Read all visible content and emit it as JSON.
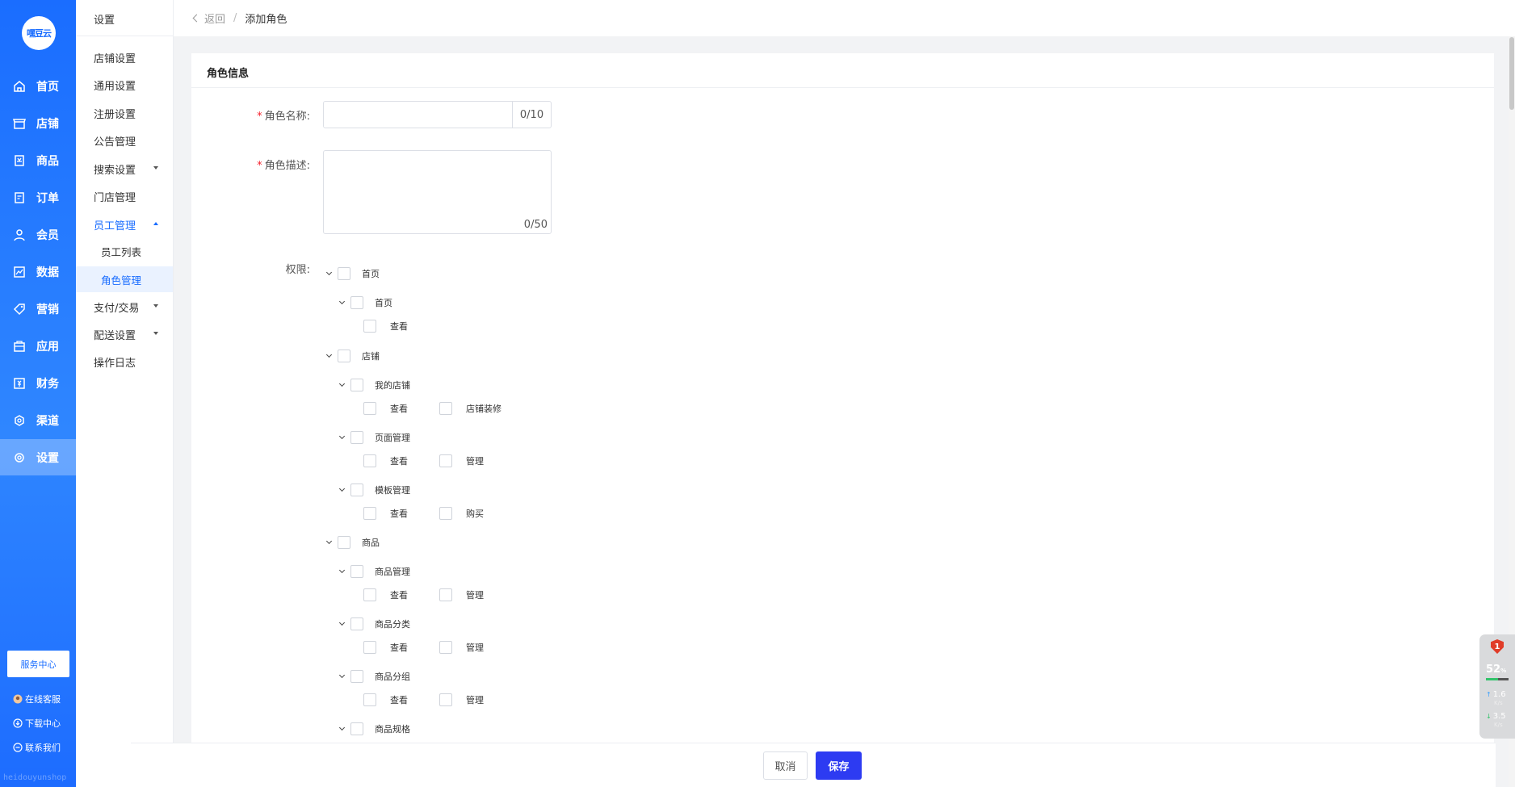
{
  "sidebar": {
    "logo": "嘿豆云",
    "items": [
      {
        "label": "首页",
        "icon": "home-icon"
      },
      {
        "label": "店铺",
        "icon": "store-icon"
      },
      {
        "label": "商品",
        "icon": "goods-icon"
      },
      {
        "label": "订单",
        "icon": "order-icon"
      },
      {
        "label": "会员",
        "icon": "user-icon"
      },
      {
        "label": "数据",
        "icon": "chart-icon"
      },
      {
        "label": "营销",
        "icon": "tag-icon"
      },
      {
        "label": "应用",
        "icon": "app-icon"
      },
      {
        "label": "财务",
        "icon": "finance-icon"
      },
      {
        "label": "渠道",
        "icon": "channel-icon"
      },
      {
        "label": "设置",
        "icon": "gear-icon",
        "active": true
      }
    ],
    "service_center": "服务中心",
    "online_service": "在线客服",
    "download_center": "下载中心",
    "contact_us": "联系我们",
    "watermark": "heidouyunshop"
  },
  "subnav": {
    "title": "设置",
    "items": [
      {
        "label": "店铺设置"
      },
      {
        "label": "通用设置"
      },
      {
        "label": "注册设置"
      },
      {
        "label": "公告管理"
      },
      {
        "label": "搜索设置",
        "caret": "down"
      },
      {
        "label": "门店管理"
      },
      {
        "label": "员工管理",
        "caret": "up",
        "expanded": true
      },
      {
        "label": "员工列表",
        "child": true
      },
      {
        "label": "角色管理",
        "child": true,
        "active": true
      },
      {
        "label": "支付/交易",
        "caret": "down"
      },
      {
        "label": "配送设置",
        "caret": "down"
      },
      {
        "label": "操作日志"
      }
    ]
  },
  "header": {
    "back": "返回",
    "separator": "/",
    "current": "添加角色"
  },
  "card": {
    "title": "角色信息",
    "name_label": "角色名称:",
    "name_value": "",
    "name_count": "0/10",
    "desc_label": "角色描述:",
    "desc_value": "",
    "desc_count": "0/50",
    "perm_label": "权限:"
  },
  "tree": [
    {
      "level": 0,
      "label": "首页",
      "toggle": true
    },
    {
      "level": 1,
      "label": "首页",
      "toggle": true
    },
    {
      "level": 2,
      "items": [
        "查看"
      ]
    },
    {
      "level": 0,
      "label": "店铺",
      "toggle": true
    },
    {
      "level": 1,
      "label": "我的店铺",
      "toggle": true
    },
    {
      "level": 2,
      "items": [
        "查看",
        "店铺装修"
      ]
    },
    {
      "level": 1,
      "label": "页面管理",
      "toggle": true
    },
    {
      "level": 2,
      "items": [
        "查看",
        "管理"
      ]
    },
    {
      "level": 1,
      "label": "模板管理",
      "toggle": true
    },
    {
      "level": 2,
      "items": [
        "查看",
        "购买"
      ]
    },
    {
      "level": 0,
      "label": "商品",
      "toggle": true
    },
    {
      "level": 1,
      "label": "商品管理",
      "toggle": true
    },
    {
      "level": 2,
      "items": [
        "查看",
        "管理"
      ]
    },
    {
      "level": 1,
      "label": "商品分类",
      "toggle": true
    },
    {
      "level": 2,
      "items": [
        "查看",
        "管理"
      ]
    },
    {
      "level": 1,
      "label": "商品分组",
      "toggle": true
    },
    {
      "level": 2,
      "items": [
        "查看",
        "管理"
      ]
    },
    {
      "level": 1,
      "label": "商品规格",
      "toggle": true
    }
  ],
  "footer": {
    "cancel": "取消",
    "save": "保存"
  },
  "monitor": {
    "alert_count": "1",
    "cpu_percent": "52",
    "cpu_unit": "%",
    "cpu_fraction": 0.52,
    "upload": "1.6",
    "download": "3.5",
    "rate_unit": "K/s"
  },
  "colors": {
    "primary": "#1a6dff",
    "save_button": "#2d3bf2",
    "required": "#f5222d"
  }
}
